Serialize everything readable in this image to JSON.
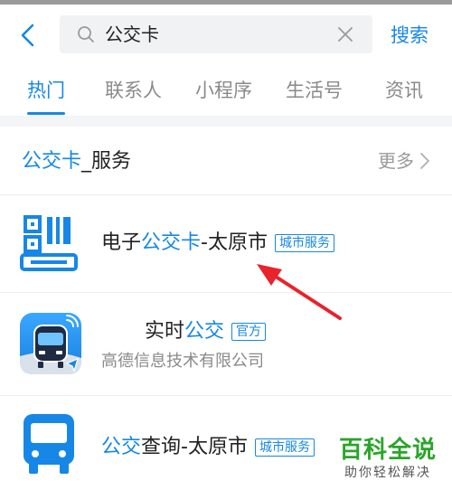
{
  "search": {
    "query": "公交卡",
    "submit_label": "搜索"
  },
  "tabs": [
    {
      "label": "热门",
      "active": true
    },
    {
      "label": "联系人",
      "active": false
    },
    {
      "label": "小程序",
      "active": false
    },
    {
      "label": "生活号",
      "active": false
    },
    {
      "label": "资讯",
      "active": false
    }
  ],
  "section": {
    "title_highlight": "公交卡",
    "title_rest": "_服务",
    "more_label": "更多"
  },
  "results": [
    {
      "pre": "电子",
      "highlight": "公交卡",
      "post": "-太原市",
      "badge": "城市服务",
      "subtitle": ""
    },
    {
      "pre": "实时",
      "highlight": "公交",
      "post": "",
      "badge": "官方",
      "subtitle": "高德信息技术有限公司"
    },
    {
      "pre": "",
      "highlight": "公交",
      "post": "查询-太原市",
      "badge": "城市服务",
      "subtitle": ""
    }
  ],
  "watermark": {
    "main": "百科全说",
    "sub": "助你轻松解决"
  },
  "colors": {
    "accent": "#1687e6",
    "annotation_arrow": "#e8232b",
    "watermark": "#2aa52a"
  }
}
